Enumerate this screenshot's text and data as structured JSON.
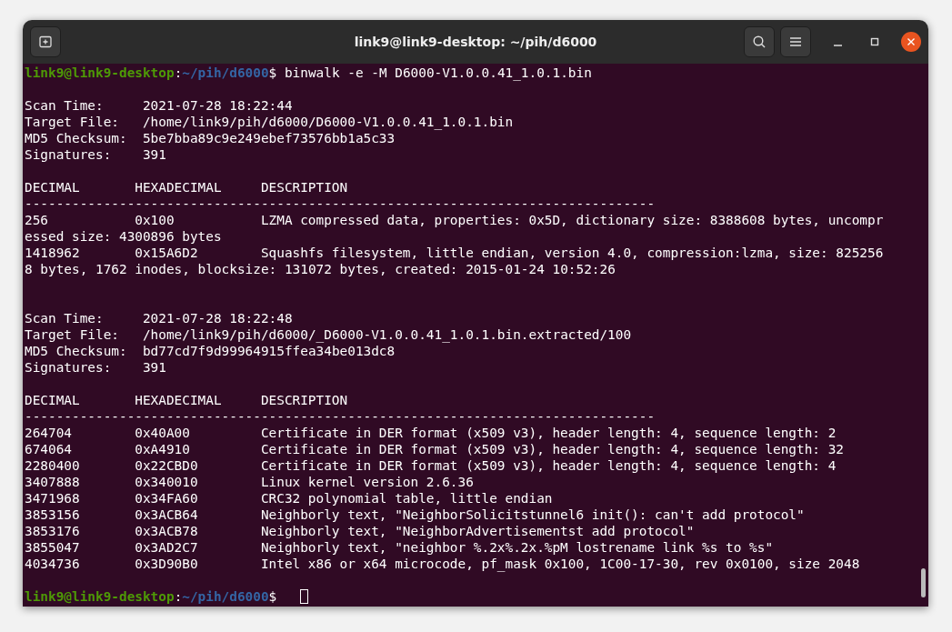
{
  "window": {
    "title": "link9@link9-desktop: ~/pih/d6000"
  },
  "lines": [
    {
      "kind": "prompt",
      "user_host": "link9@link9-desktop",
      "separator": ":",
      "path": "~/pih/d6000",
      "symbol": "$",
      "command": "binwalk -e -M D6000-V1.0.0.41_1.0.1.bin",
      "cursor": false
    },
    {
      "kind": "blank"
    },
    {
      "kind": "field",
      "label": "Scan Time:",
      "value": "2021-07-28 18:22:44"
    },
    {
      "kind": "field",
      "label": "Target File:",
      "value": "/home/link9/pih/d6000/D6000-V1.0.0.41_1.0.1.bin"
    },
    {
      "kind": "field",
      "label": "MD5 Checksum:",
      "value": "5be7bba89c9e249ebef73576bb1a5c33"
    },
    {
      "kind": "field",
      "label": "Signatures:",
      "value": "391"
    },
    {
      "kind": "blank"
    },
    {
      "kind": "row",
      "decimal": "DECIMAL",
      "hex": "HEXADECIMAL",
      "description": "DESCRIPTION"
    },
    {
      "kind": "text",
      "text": "--------------------------------------------------------------------------------"
    },
    {
      "kind": "row",
      "decimal": "256",
      "hex": "0x100",
      "description": "LZMA compressed data, properties: 0x5D, dictionary size: 8388608 bytes, uncompr"
    },
    {
      "kind": "text",
      "text": "essed size: 4300896 bytes"
    },
    {
      "kind": "row",
      "decimal": "1418962",
      "hex": "0x15A6D2",
      "description": "Squashfs filesystem, little endian, version 4.0, compression:lzma, size: 825256"
    },
    {
      "kind": "text",
      "text": "8 bytes, 1762 inodes, blocksize: 131072 bytes, created: 2015-01-24 10:52:26"
    },
    {
      "kind": "blank"
    },
    {
      "kind": "blank"
    },
    {
      "kind": "field",
      "label": "Scan Time:",
      "value": "2021-07-28 18:22:48"
    },
    {
      "kind": "field",
      "label": "Target File:",
      "value": "/home/link9/pih/d6000/_D6000-V1.0.0.41_1.0.1.bin.extracted/100"
    },
    {
      "kind": "field",
      "label": "MD5 Checksum:",
      "value": "bd77cd7f9d99964915ffea34be013dc8"
    },
    {
      "kind": "field",
      "label": "Signatures:",
      "value": "391"
    },
    {
      "kind": "blank"
    },
    {
      "kind": "row",
      "decimal": "DECIMAL",
      "hex": "HEXADECIMAL",
      "description": "DESCRIPTION"
    },
    {
      "kind": "text",
      "text": "--------------------------------------------------------------------------------"
    },
    {
      "kind": "row",
      "decimal": "264704",
      "hex": "0x40A00",
      "description": "Certificate in DER format (x509 v3), header length: 4, sequence length: 2"
    },
    {
      "kind": "row",
      "decimal": "674064",
      "hex": "0xA4910",
      "description": "Certificate in DER format (x509 v3), header length: 4, sequence length: 32"
    },
    {
      "kind": "row",
      "decimal": "2280400",
      "hex": "0x22CBD0",
      "description": "Certificate in DER format (x509 v3), header length: 4, sequence length: 4"
    },
    {
      "kind": "row",
      "decimal": "3407888",
      "hex": "0x340010",
      "description": "Linux kernel version 2.6.36"
    },
    {
      "kind": "row",
      "decimal": "3471968",
      "hex": "0x34FA60",
      "description": "CRC32 polynomial table, little endian"
    },
    {
      "kind": "row",
      "decimal": "3853156",
      "hex": "0x3ACB64",
      "description": "Neighborly text, \"NeighborSolicitstunnel6 init(): can't add protocol\""
    },
    {
      "kind": "row",
      "decimal": "3853176",
      "hex": "0x3ACB78",
      "description": "Neighborly text, \"NeighborAdvertisementst add protocol\""
    },
    {
      "kind": "row",
      "decimal": "3855047",
      "hex": "0x3AD2C7",
      "description": "Neighborly text, \"neighbor %.2x%.2x.%pM lostrename link %s to %s\""
    },
    {
      "kind": "row",
      "decimal": "4034736",
      "hex": "0x3D90B0",
      "description": "Intel x86 or x64 microcode, pf_mask 0x100, 1C00-17-30, rev 0x0100, size 2048"
    },
    {
      "kind": "blank"
    },
    {
      "kind": "prompt",
      "user_host": "link9@link9-desktop",
      "separator": ":",
      "path": "~/pih/d6000",
      "symbol": "$",
      "cursor": true
    }
  ]
}
